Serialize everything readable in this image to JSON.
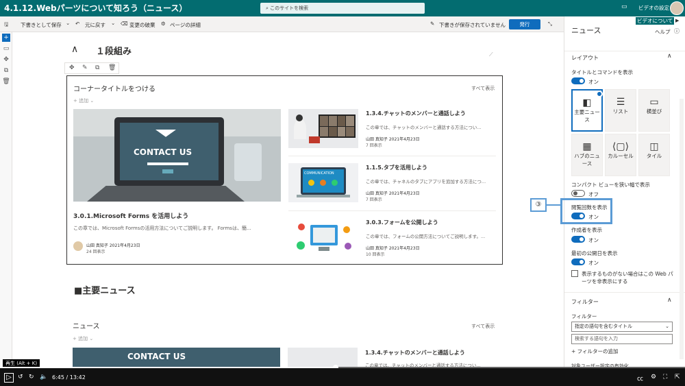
{
  "video": {
    "title": "4.1.12.Webパーツについて知ろう（ニュース）",
    "search_placeholder": "このサイトを検索",
    "top_right": "ビデオの設定",
    "time": "6:45 / 13:42",
    "progress": 0.49,
    "tooltip": "再生 (Alt + K)"
  },
  "cmdbar": {
    "save_draft": "下書きとして保存",
    "undo": "元に戻す",
    "discard": "変更の破棄",
    "page_details": "ページの詳細",
    "draft_saved": "下書きが保存されていません",
    "publish": "発行"
  },
  "section1": {
    "heading": "１段組み",
    "webpart_title": "コーナータイトルをつける",
    "see_all": "すべて表示",
    "add": "追加",
    "main_news": {
      "title": "3.0.1.Microsoft Forms を活用しよう",
      "body": "この章では、Microsoft Formsの活用方法についてご説明します。 Formsは、簡...",
      "author": "山田 真知子",
      "date": "2021年4月23日",
      "views": "24 回表示",
      "image_text": "CONTACT US"
    },
    "side_news": [
      {
        "title": "1.3.4.チャットのメンバーと通話しよう",
        "body": "この章では、チャットのメンバーと通話する方法につい...",
        "author": "山田 真知子",
        "date": "2021年4月23日",
        "views": "7 回表示"
      },
      {
        "title": "1.1.5.タブを活用しよう",
        "body": "この章では、チャネルのタブにアプリを追加する方法につ...",
        "author": "山田 真知子",
        "date": "2021年4月23日",
        "views": "7 回表示",
        "image_text": "COMMUNICATION"
      },
      {
        "title": "3.0.3.フォームを公開しよう",
        "body": "この章では、フォームの公開方法についてご説明します。...",
        "author": "山田 真知子",
        "date": "2021年4月23日",
        "views": "10 回表示"
      }
    ]
  },
  "section2": {
    "heading": "■主要ニュース",
    "webpart_title": "ニュース",
    "see_all": "すべて表示",
    "add": "追加",
    "side_news_title": "1.3.4.チャットのメンバーと通話しよう",
    "side_news_body": "この章では、チャットのメンバーと通話する方法につい...",
    "image_text": "CONTACT US"
  },
  "panel": {
    "title": "ニュース",
    "video_about": "ビデオについて",
    "help": "ヘルプ",
    "layout_header": "レイアウト",
    "title_cmd_label": "タイトルとコマンドを表示",
    "on": "オン",
    "off": "オフ",
    "layouts": [
      {
        "label": "主要ニュース",
        "icon": "layout-top-story-icon"
      },
      {
        "label": "リスト",
        "icon": "layout-list-icon"
      },
      {
        "label": "横並び",
        "icon": "layout-side-by-side-icon"
      },
      {
        "label": "ハブのニュース",
        "icon": "layout-hub-news-icon"
      },
      {
        "label": "カルーセル",
        "icon": "layout-carousel-icon"
      },
      {
        "label": "タイル",
        "icon": "layout-tiles-icon"
      }
    ],
    "compact_label": "コンパクト ビューを狭い幅で表示",
    "view_count_label": "閲覧回数を表示",
    "author_label": "作成者を表示",
    "publish_date_label": "最初の公開日を表示",
    "hide_if_empty": "表示するものがない場合はこの Web パーツを非表示にする",
    "filter_header": "フィルター",
    "filter_label": "フィルター",
    "filter_select": "指定の語句を含むタイトル",
    "filter_input_placeholder": "検索する語句を入力",
    "add_filter": "フィルターの追加",
    "audience_label": "対象ユーザー設定の有効化",
    "callout": "③"
  }
}
